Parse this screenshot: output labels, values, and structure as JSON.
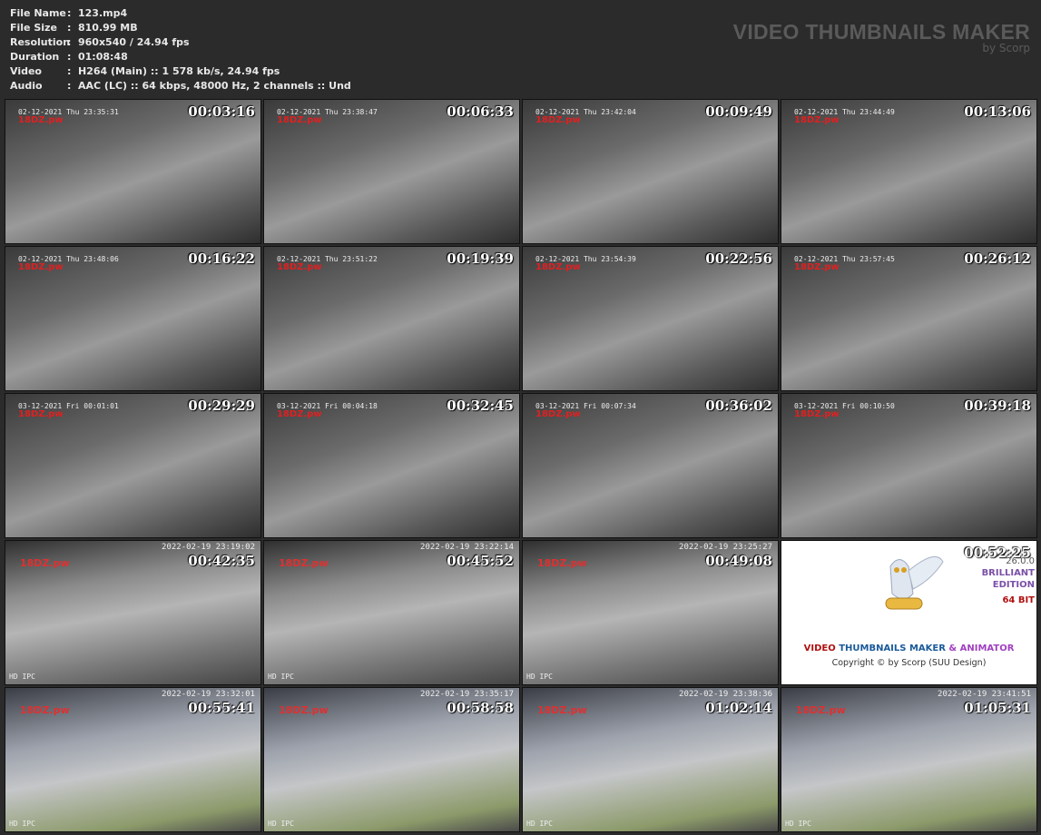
{
  "file_info": [
    {
      "label": "File Name",
      "value": "123.mp4"
    },
    {
      "label": "File Size",
      "value": "810.99 MB"
    },
    {
      "label": "Resolution",
      "value": "960x540 / 24.94 fps"
    },
    {
      "label": "Duration",
      "value": "01:08:48"
    },
    {
      "label": "Video",
      "value": "H264 (Main) :: 1 578 kb/s, 24.94 fps"
    },
    {
      "label": "Audio",
      "value": "AAC (LC) :: 64 kbps, 48000 Hz, 2 channels :: Und"
    }
  ],
  "separator": ":",
  "brand": {
    "title": "VIDEO THUMBNAILS MAKER",
    "subtitle": "by Scorp"
  },
  "thumbnails": [
    {
      "time": "00:03:16",
      "cam": "02-12-2021 Thu 23:35:31",
      "wm": "18DZ.pw",
      "style": "a"
    },
    {
      "time": "00:06:33",
      "cam": "02-12-2021 Thu 23:38:47",
      "wm": "18DZ.pw",
      "style": "a"
    },
    {
      "time": "00:09:49",
      "cam": "02-12-2021 Thu 23:42:04",
      "wm": "18DZ.pw",
      "style": "a"
    },
    {
      "time": "00:13:06",
      "cam": "02-12-2021 Thu 23:44:49",
      "wm": "18DZ.pw",
      "style": "a"
    },
    {
      "time": "00:16:22",
      "cam": "02-12-2021 Thu 23:48:06",
      "wm": "18DZ.pw",
      "style": "a"
    },
    {
      "time": "00:19:39",
      "cam": "02-12-2021 Thu 23:51:22",
      "wm": "18DZ.pw",
      "style": "a"
    },
    {
      "time": "00:22:56",
      "cam": "02-12-2021 Thu 23:54:39",
      "wm": "18DZ.pw",
      "style": "a"
    },
    {
      "time": "00:26:12",
      "cam": "02-12-2021 Thu 23:57:45",
      "wm": "18DZ.pw",
      "style": "a"
    },
    {
      "time": "00:29:29",
      "cam": "03-12-2021 Fri 00:01:01",
      "wm": "18DZ.pw",
      "style": "a"
    },
    {
      "time": "00:32:45",
      "cam": "03-12-2021 Fri 00:04:18",
      "wm": "18DZ.pw",
      "style": "a"
    },
    {
      "time": "00:36:02",
      "cam": "03-12-2021 Fri 00:07:34",
      "wm": "18DZ.pw",
      "style": "a"
    },
    {
      "time": "00:39:18",
      "cam": "03-12-2021 Fri 00:10:50",
      "wm": "18DZ.pw",
      "style": "a"
    },
    {
      "time": "00:42:35",
      "cam": "2022-02-19 23:19:02",
      "wm": "18DZ.pw",
      "hd": "HD IPC",
      "style": "b"
    },
    {
      "time": "00:45:52",
      "cam": "2022-02-19 23:22:14",
      "wm": "18DZ.pw",
      "hd": "HD IPC",
      "style": "b"
    },
    {
      "time": "00:49:08",
      "cam": "2022-02-19 23:25:27",
      "wm": "18DZ.pw",
      "hd": "HD IPC",
      "style": "b"
    },
    {
      "time": "00:52:25",
      "logo": true
    },
    {
      "time": "00:55:41",
      "cam": "2022-02-19 23:32:01",
      "wm": "18DZ.pw",
      "hd": "HD IPC",
      "style": "c"
    },
    {
      "time": "00:58:58",
      "cam": "2022-02-19 23:35:17",
      "wm": "18DZ.pw",
      "hd": "HD IPC",
      "style": "c"
    },
    {
      "time": "01:02:14",
      "cam": "2022-02-19 23:38:36",
      "wm": "18DZ.pw",
      "hd": "HD IPC",
      "style": "c"
    },
    {
      "time": "01:05:31",
      "cam": "2022-02-19 23:41:51",
      "wm": "18DZ.pw",
      "hd": "HD IPC",
      "style": "c"
    }
  ],
  "logo_panel": {
    "version": "26.0.0",
    "edition_1": "BRILLIANT",
    "edition_2": "EDITION",
    "bits": "64 BIT",
    "name_1": "VIDEO",
    "name_2": "THUMBNAILS MAKER",
    "name_3": "& ANIMATOR",
    "copyright": "Copyright © by Scorp (SUU Design)",
    "colors": {
      "video": "#b01010",
      "thumbs": "#1a5a9a",
      "animator": "#a040c0"
    }
  }
}
